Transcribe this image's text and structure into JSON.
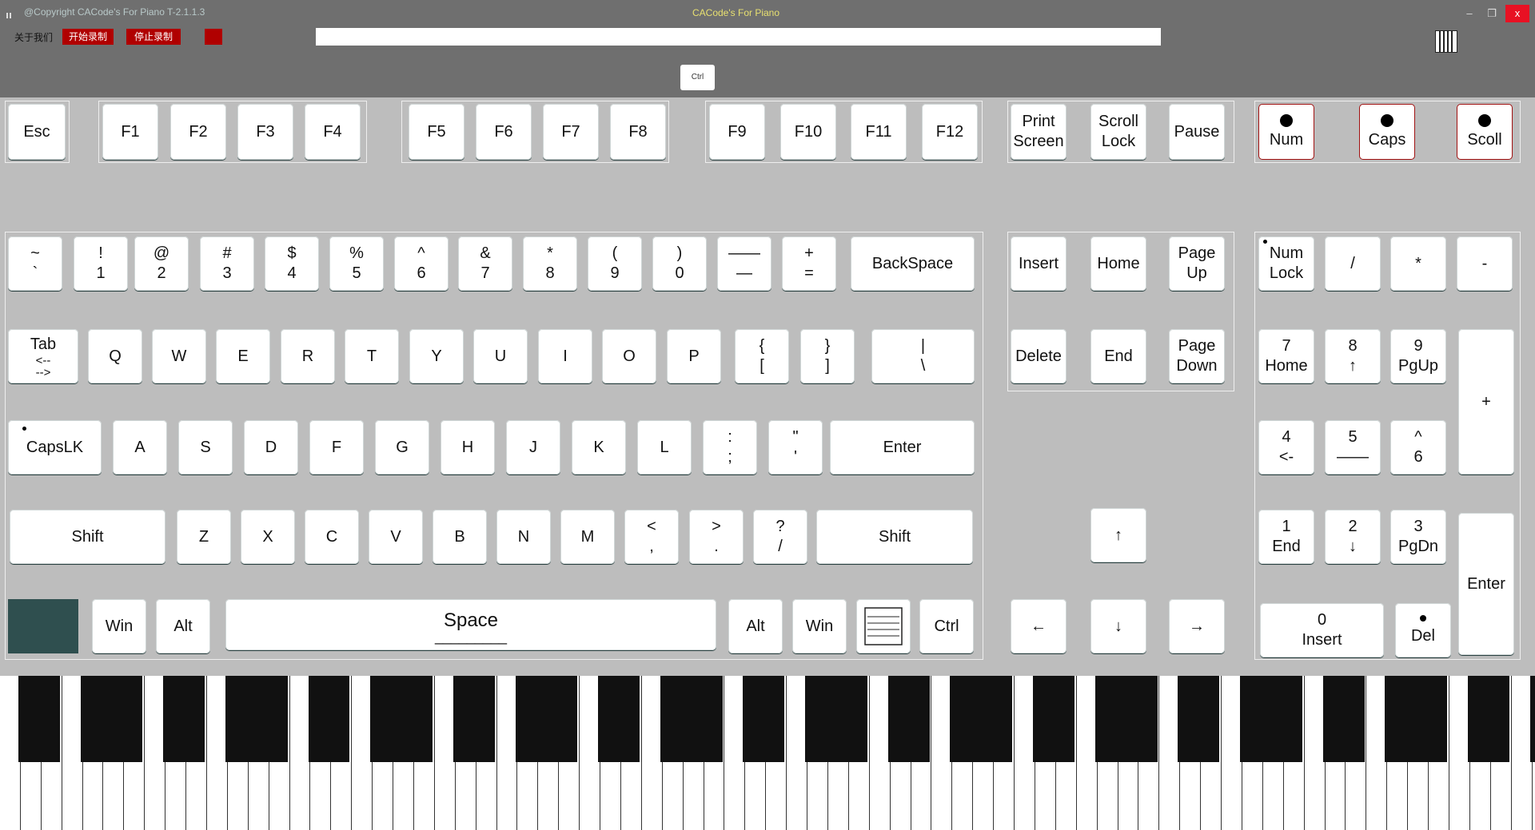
{
  "window": {
    "copyright": "@Copyright CACode's For Piano T-2.1.1.3",
    "title": "CACode's For Piano",
    "minimize": "–",
    "maximize": "❐",
    "close": "x"
  },
  "toolbar": {
    "about": "关于我们",
    "start_record": "开始录制",
    "stop_record": "停止录制",
    "record_value": "",
    "active_key": "Ctrl"
  },
  "keyboard": {
    "fn_row": [
      "Esc",
      "F1",
      "F2",
      "F3",
      "F4",
      "F5",
      "F6",
      "F7",
      "F8",
      "F9",
      "F10",
      "F11",
      "F12"
    ],
    "sys": {
      "print_top": "Print",
      "print_bot": "Screen",
      "scroll_top": "Scroll",
      "scroll_bot": "Lock",
      "pause": "Pause"
    },
    "locks": {
      "num": "Num",
      "caps": "Caps",
      "scroll": "Scoll"
    },
    "number_row": [
      [
        "~",
        "`"
      ],
      [
        "!",
        "1"
      ],
      [
        "@",
        "2"
      ],
      [
        "#",
        "3"
      ],
      [
        "$",
        "4"
      ],
      [
        "%",
        "5"
      ],
      [
        "^",
        "6"
      ],
      [
        "&",
        "7"
      ],
      [
        "*",
        "8"
      ],
      [
        "(",
        "9"
      ],
      [
        ")",
        "0"
      ],
      [
        "——",
        "—"
      ],
      [
        "+",
        "="
      ]
    ],
    "backspace": "BackSpace",
    "tab_top": "Tab",
    "tab_bot": "<--\n-->",
    "qrow": [
      "Q",
      "W",
      "E",
      "R",
      "T",
      "Y",
      "U",
      "I",
      "O",
      "P"
    ],
    "brackets": [
      [
        "{",
        "["
      ],
      [
        "}",
        "]"
      ],
      [
        "|",
        "\\"
      ]
    ],
    "capslock": "CapsLK",
    "arow": [
      "A",
      "S",
      "D",
      "F",
      "G",
      "H",
      "J",
      "K",
      "L"
    ],
    "semi": [
      [
        ":",
        ";"
      ],
      [
        "\"",
        "'"
      ]
    ],
    "enter": "Enter",
    "shift": "Shift",
    "zrow": [
      "Z",
      "X",
      "C",
      "V",
      "B",
      "N",
      "M"
    ],
    "punct": [
      [
        "<",
        ","
      ],
      [
        ">",
        "."
      ],
      [
        "?",
        "/"
      ]
    ],
    "win": "Win",
    "alt": "Alt",
    "space": "Space",
    "space_underline": "_________",
    "ctrl": "Ctrl",
    "nav": {
      "insert": "Insert",
      "home": "Home",
      "pgup_top": "Page",
      "pgup_bot": "Up",
      "delete": "Delete",
      "end": "End",
      "pgdn_top": "Page",
      "pgdn_bot": "Down"
    },
    "arrows": {
      "up": "↑",
      "left": "←",
      "down": "↓",
      "right": "→"
    },
    "numpad": {
      "numlock_top": "Num",
      "numlock_bot": "Lock",
      "div": "/",
      "mul": "*",
      "minus": "-",
      "plus": "+",
      "k7": [
        "7",
        "Home"
      ],
      "k8": [
        "8",
        "↑"
      ],
      "k9": [
        "9",
        "PgUp"
      ],
      "k4": [
        "4",
        "<-"
      ],
      "k5": [
        "5",
        "——"
      ],
      "k6": [
        "^",
        "6"
      ],
      "k1": [
        "1",
        "End"
      ],
      "k2": [
        "2",
        "↓"
      ],
      "k3": [
        "3",
        "PgDn"
      ],
      "k0": [
        "0",
        "Insert"
      ],
      "del": "Del",
      "enter": "Enter"
    }
  }
}
